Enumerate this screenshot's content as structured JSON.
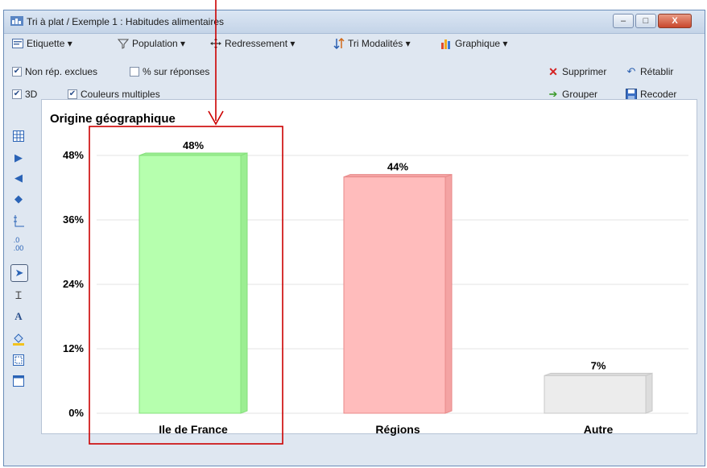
{
  "window": {
    "title": "Tri à plat / Exemple 1 : Habitudes alimentaires",
    "minimize_glyph": "–",
    "maximize_glyph": "□",
    "close_glyph": "X"
  },
  "toolbar1": {
    "etiquette": "Etiquette ▾",
    "population": "Population ▾",
    "redressement": "Redressement ▾",
    "tri_modalites": "Tri Modalités ▾",
    "graphique": "Graphique ▾"
  },
  "toolbar2": {
    "non_rep_exclues": "Non rép. exclues",
    "pct_sur_reponses": "% sur réponses",
    "supprimer": "Supprimer",
    "retablir": "Rétablir"
  },
  "toolbar3": {
    "label_3d": "3D",
    "couleurs_multiples": "Couleurs multiples",
    "grouper": "Grouper",
    "recoder": "Recoder"
  },
  "checkboxes": {
    "non_rep_exclues": true,
    "pct_sur_reponses": false,
    "label_3d": true,
    "couleurs_multiples": true
  },
  "icons": {
    "etiquette": "label-icon",
    "population": "filter-icon",
    "redressement": "move-icon",
    "tri_modalites": "sort-icon",
    "graphique": "bar-chart-icon",
    "supprimer": "delete-x-icon",
    "retablir": "undo-icon",
    "grouper": "arrow-right-icon",
    "recoder": "save-disk-icon",
    "left_tools": [
      "table-icon",
      "play-right-icon",
      "play-left-icon",
      "diamond-arrows-icon",
      "axis-icon",
      "decimal-icon",
      "pointer-icon",
      "text-cursor-icon",
      "text-a-icon",
      "paint-bucket-icon",
      "frame-icon",
      "window-icon"
    ]
  },
  "colors": {
    "green": "#b6ffae",
    "red": "#ffbcbc",
    "gray": "#ececec",
    "annotation": "#cc0000"
  },
  "chart_data": {
    "type": "bar",
    "title": "Origine géographique",
    "categories": [
      "Ile de France",
      "Régions",
      "Autre"
    ],
    "values": [
      48,
      44,
      7
    ],
    "data_labels": [
      "48%",
      "44%",
      "7%"
    ],
    "y_ticks": [
      "0%",
      "12%",
      "24%",
      "36%",
      "48%"
    ],
    "ylim": [
      0,
      52
    ],
    "grid": true,
    "style": "3D",
    "highlighted_category": "Ile de France"
  }
}
